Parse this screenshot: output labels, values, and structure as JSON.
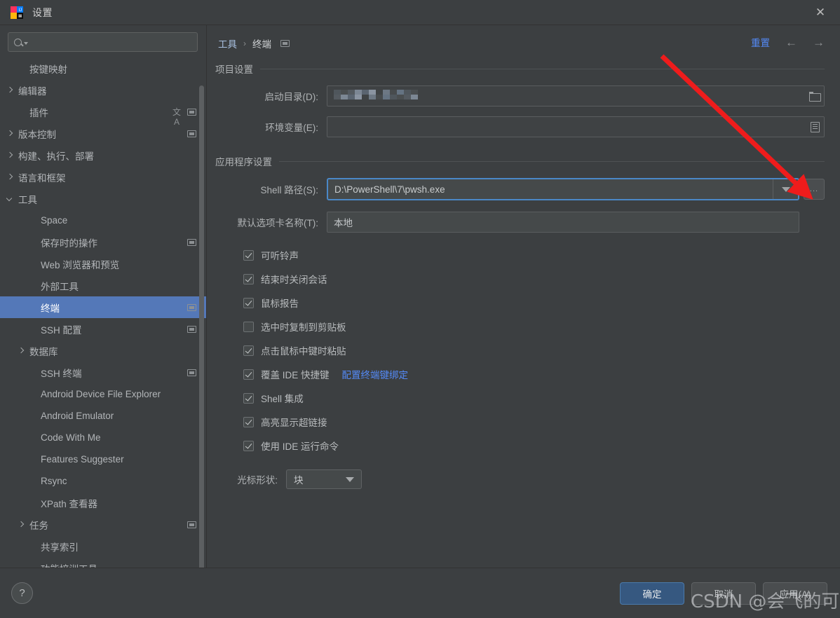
{
  "window": {
    "title": "设置",
    "app_icon": "intellij-idea-icon",
    "close_label": "✕"
  },
  "sidebar": {
    "search": {
      "placeholder": "",
      "value": "",
      "icon": "search-icon"
    },
    "items": [
      {
        "label": "按键映射",
        "indent": 1,
        "arrow": "none",
        "badge": false,
        "selected": false
      },
      {
        "label": "编辑器",
        "indent": 0,
        "arrow": "collapsed",
        "badge": false,
        "selected": false
      },
      {
        "label": "插件",
        "indent": 1,
        "arrow": "none",
        "badge": true,
        "translate": true,
        "selected": false
      },
      {
        "label": "版本控制",
        "indent": 0,
        "arrow": "collapsed",
        "badge": true,
        "selected": false
      },
      {
        "label": "构建、执行、部署",
        "indent": 0,
        "arrow": "collapsed",
        "badge": false,
        "selected": false
      },
      {
        "label": "语言和框架",
        "indent": 0,
        "arrow": "collapsed",
        "badge": false,
        "selected": false
      },
      {
        "label": "工具",
        "indent": 0,
        "arrow": "expanded",
        "badge": false,
        "selected": false
      },
      {
        "label": "Space",
        "indent": 2,
        "arrow": "none",
        "badge": false,
        "selected": false
      },
      {
        "label": "保存时的操作",
        "indent": 2,
        "arrow": "none",
        "badge": true,
        "selected": false
      },
      {
        "label": "Web 浏览器和预览",
        "indent": 2,
        "arrow": "none",
        "badge": false,
        "selected": false
      },
      {
        "label": "外部工具",
        "indent": 2,
        "arrow": "none",
        "badge": false,
        "selected": false
      },
      {
        "label": "终端",
        "indent": 2,
        "arrow": "none",
        "badge": true,
        "selected": true
      },
      {
        "label": "SSH 配置",
        "indent": 2,
        "arrow": "none",
        "badge": true,
        "selected": false
      },
      {
        "label": "数据库",
        "indent": 1,
        "arrow": "collapsed",
        "badge": false,
        "selected": false
      },
      {
        "label": "SSH 终端",
        "indent": 2,
        "arrow": "none",
        "badge": true,
        "selected": false
      },
      {
        "label": "Android Device File Explorer",
        "indent": 2,
        "arrow": "none",
        "badge": false,
        "selected": false
      },
      {
        "label": "Android Emulator",
        "indent": 2,
        "arrow": "none",
        "badge": false,
        "selected": false
      },
      {
        "label": "Code With Me",
        "indent": 2,
        "arrow": "none",
        "badge": false,
        "selected": false
      },
      {
        "label": "Features Suggester",
        "indent": 2,
        "arrow": "none",
        "badge": false,
        "selected": false
      },
      {
        "label": "Rsync",
        "indent": 2,
        "arrow": "none",
        "badge": false,
        "selected": false
      },
      {
        "label": "XPath 查看器",
        "indent": 2,
        "arrow": "none",
        "badge": false,
        "selected": false
      },
      {
        "label": "任务",
        "indent": 1,
        "arrow": "collapsed",
        "badge": true,
        "selected": false
      },
      {
        "label": "共享索引",
        "indent": 2,
        "arrow": "none",
        "badge": false,
        "selected": false
      },
      {
        "label": "功能培训工具",
        "indent": 2,
        "arrow": "none",
        "badge": false,
        "selected": false
      }
    ]
  },
  "content": {
    "breadcrumb": {
      "root": "工具",
      "separator": "›",
      "leaf": "终端",
      "badge": "project-scope-icon"
    },
    "reset_label": "重置",
    "back_icon": "←",
    "forward_icon": "→",
    "project_section": {
      "title": "项目设置",
      "start_dir": {
        "label": "启动目录(D):",
        "value": "",
        "censored": true,
        "icon": "folder-icon"
      },
      "env_vars": {
        "label": "环境变量(E):",
        "value": "",
        "icon": "environment-list-icon"
      }
    },
    "app_section": {
      "title": "应用程序设置",
      "shell_path": {
        "label": "Shell 路径(S):",
        "value": "D:\\PowerShell\\7\\pwsh.exe",
        "focused": true,
        "dropdown_icon": "chevron-down-icon",
        "browse_label": "..."
      },
      "tab_name": {
        "label": "默认选项卡名称(T):",
        "value": "本地"
      },
      "checkboxes": [
        {
          "label": "可听铃声",
          "checked": true
        },
        {
          "label": "结束时关闭会话",
          "checked": true
        },
        {
          "label": "鼠标报告",
          "checked": true
        },
        {
          "label": "选中时复制到剪贴板",
          "checked": false
        },
        {
          "label": "点击鼠标中键时粘贴",
          "checked": true
        },
        {
          "label": "覆盖 IDE 快捷键",
          "checked": true,
          "link": "配置终端键绑定"
        },
        {
          "label": "Shell 集成",
          "checked": true
        },
        {
          "label": "高亮显示超链接",
          "checked": true
        },
        {
          "label": "使用 IDE 运行命令",
          "checked": true
        }
      ],
      "cursor_shape": {
        "label": "光标形状:",
        "value": "块"
      }
    }
  },
  "footer": {
    "help_label": "?",
    "ok_label": "确定",
    "cancel_label": "取消",
    "apply_label": "应用(A)"
  },
  "annotations": {
    "arrow_color": "#ee1c1c",
    "watermark": "CSDN @会飞的可达鸭"
  },
  "colors": {
    "window_bg": "#3c3f41",
    "selection_blue": "#5478b8",
    "link_blue": "#548af7",
    "focus_border": "#4a88c7",
    "primary_button": "#365880"
  }
}
